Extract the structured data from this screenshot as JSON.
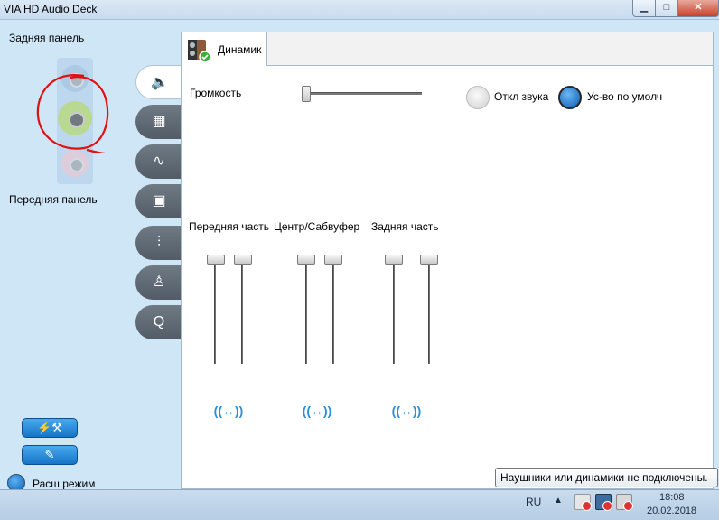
{
  "window": {
    "title": "VIA HD Audio Deck"
  },
  "left_panel": {
    "rear_label": "Задняя панель",
    "front_label": "Передняя панель",
    "advanced_mode_label": "Расш.режим"
  },
  "tab": {
    "label": "Динамик"
  },
  "volume": {
    "label": "Громкость",
    "level_percent": 0
  },
  "mute_radio": {
    "label": "Откл звука",
    "selected": false
  },
  "default_radio": {
    "label": "Ус-во по умолч",
    "selected": true
  },
  "channel_groups": [
    {
      "label": "Передняя часть"
    },
    {
      "label": "Центр/Сабвуфер"
    },
    {
      "label": "Задняя часть"
    }
  ],
  "tooltip": {
    "text": "Наушники или динамики не подключены."
  },
  "taskbar": {
    "language": "RU",
    "time": "18:08",
    "date": "20.02.2018"
  },
  "colors": {
    "panel_bg": "#cfe6f7",
    "accent_blue": "#1574c8",
    "annotation_red": "#e01010"
  }
}
